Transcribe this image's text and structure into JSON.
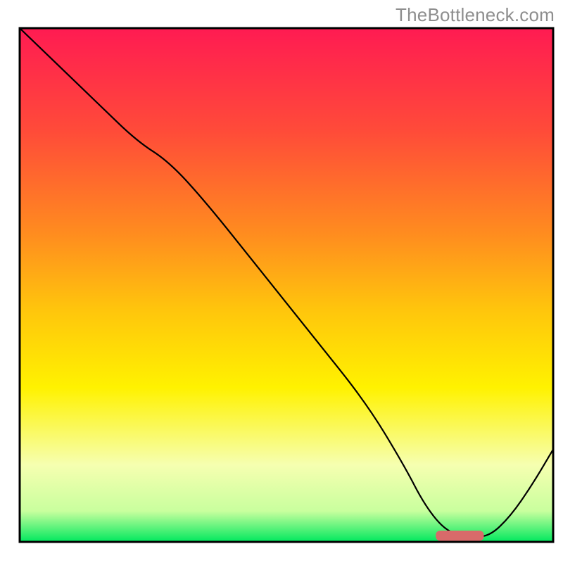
{
  "watermark": "TheBottleneck.com",
  "chart_data": {
    "type": "line",
    "title": "",
    "xlabel": "",
    "ylabel": "",
    "xlim": [
      0,
      100
    ],
    "ylim": [
      0,
      100
    ],
    "axes_visible": false,
    "background_gradient": {
      "stops": [
        {
          "offset": 0.0,
          "color": "#ff1b52"
        },
        {
          "offset": 0.2,
          "color": "#ff4b39"
        },
        {
          "offset": 0.4,
          "color": "#ff8c1f"
        },
        {
          "offset": 0.55,
          "color": "#ffc60c"
        },
        {
          "offset": 0.7,
          "color": "#fff200"
        },
        {
          "offset": 0.85,
          "color": "#f6ffb0"
        },
        {
          "offset": 0.94,
          "color": "#c9ff9e"
        },
        {
          "offset": 1.0,
          "color": "#00e85e"
        }
      ]
    },
    "series": [
      {
        "name": "bottleneck-curve",
        "color": "#000000",
        "stroke_width": 2.2,
        "x": [
          0,
          8,
          15,
          22,
          28,
          35,
          45,
          55,
          65,
          72,
          76,
          80,
          84,
          88,
          92,
          96,
          100
        ],
        "y": [
          100,
          92,
          85,
          78,
          74,
          66,
          53,
          40,
          27,
          15,
          7,
          2,
          1,
          1,
          5,
          11,
          18
        ]
      }
    ],
    "marker": {
      "name": "optimal-range-marker",
      "color": "#d86a6a",
      "x_start": 78,
      "x_end": 87,
      "y": 1.2,
      "thickness": 2.0
    }
  }
}
